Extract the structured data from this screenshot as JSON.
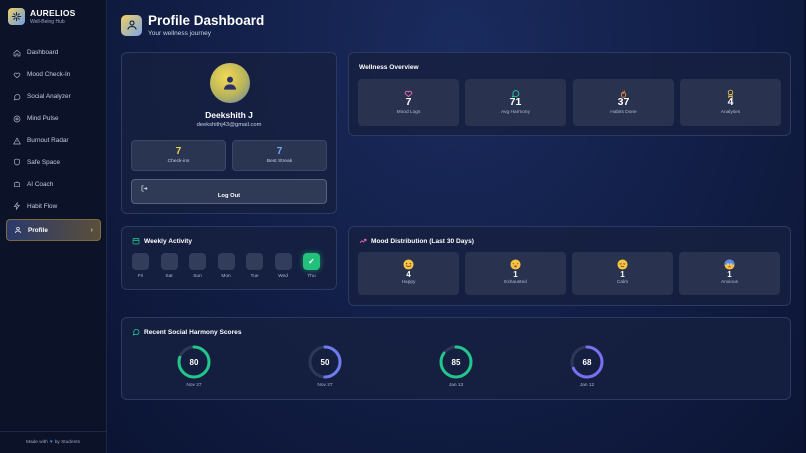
{
  "app": {
    "name": "AURELIOS",
    "tagline": "Well-Being Hub"
  },
  "sidebar": {
    "items": [
      {
        "label": "Dashboard",
        "icon": "home-icon"
      },
      {
        "label": "Mood Check-In",
        "icon": "heart-icon"
      },
      {
        "label": "Social Analyzer",
        "icon": "chat-bubble-icon"
      },
      {
        "label": "Mind Pulse",
        "icon": "pulse-icon"
      },
      {
        "label": "Burnout Radar",
        "icon": "warning-icon"
      },
      {
        "label": "Safe Space",
        "icon": "shield-icon"
      },
      {
        "label": "AI Coach",
        "icon": "bot-icon"
      },
      {
        "label": "Habit Flow",
        "icon": "lightning-icon"
      },
      {
        "label": "Profile",
        "icon": "user-icon",
        "active": true
      }
    ],
    "footer": {
      "prefix": "Made with",
      "suffix": "by Students"
    }
  },
  "header": {
    "title": "Profile Dashboard",
    "subtitle": "Your wellness journey"
  },
  "profile": {
    "name": "Deekshith J",
    "email": "deekshithj43@gmail.com",
    "checkins": {
      "value": "7",
      "label": "Check-ins",
      "color": "#f2d24a"
    },
    "best_streak": {
      "value": "7",
      "label": "Best Streak",
      "color": "#6ea8ff"
    },
    "logout_label": "Log Out"
  },
  "wellness": {
    "title": "Wellness Overview",
    "tiles": [
      {
        "value": "7",
        "label": "Mood Logs",
        "icon": "heart-icon",
        "color": "#f472b6"
      },
      {
        "value": "71",
        "label": "Avg Harmony",
        "icon": "chat-bubble-icon",
        "color": "#22d3aa"
      },
      {
        "value": "37",
        "label": "Habits Done",
        "icon": "flame-icon",
        "color": "#fb923c"
      },
      {
        "value": "4",
        "label": "Analyses",
        "icon": "award-icon",
        "color": "#f2d24a"
      }
    ]
  },
  "weekly": {
    "title": "Weekly Activity",
    "days": [
      {
        "label": "Fri",
        "done": false
      },
      {
        "label": "Sat",
        "done": false
      },
      {
        "label": "Sun",
        "done": false
      },
      {
        "label": "Mon",
        "done": false
      },
      {
        "label": "Tue",
        "done": false
      },
      {
        "label": "Wed",
        "done": false
      },
      {
        "label": "Thu",
        "done": true
      }
    ],
    "check_mark": "✓"
  },
  "mood": {
    "title": "Mood Distribution (Last 30 Days)",
    "tiles": [
      {
        "value": "4",
        "label": "Happy",
        "icon": "happy-emoji-icon"
      },
      {
        "value": "1",
        "label": "Exhausted",
        "icon": "exhausted-emoji-icon"
      },
      {
        "value": "1",
        "label": "Calm",
        "icon": "calm-emoji-icon"
      },
      {
        "value": "1",
        "label": "Anxious",
        "icon": "anxious-emoji-icon"
      }
    ]
  },
  "harmony": {
    "title": "Recent Social Harmony Scores",
    "scores": [
      {
        "value": 80,
        "date": "Nov 27",
        "color": "#22c58a"
      },
      {
        "value": 50,
        "date": "Nov 27",
        "color": "#6f7cf0"
      },
      {
        "value": 85,
        "date": "Jan 13",
        "color": "#22c58a"
      },
      {
        "value": 68,
        "date": "Jan 12",
        "color": "#7a6ff0"
      }
    ]
  }
}
